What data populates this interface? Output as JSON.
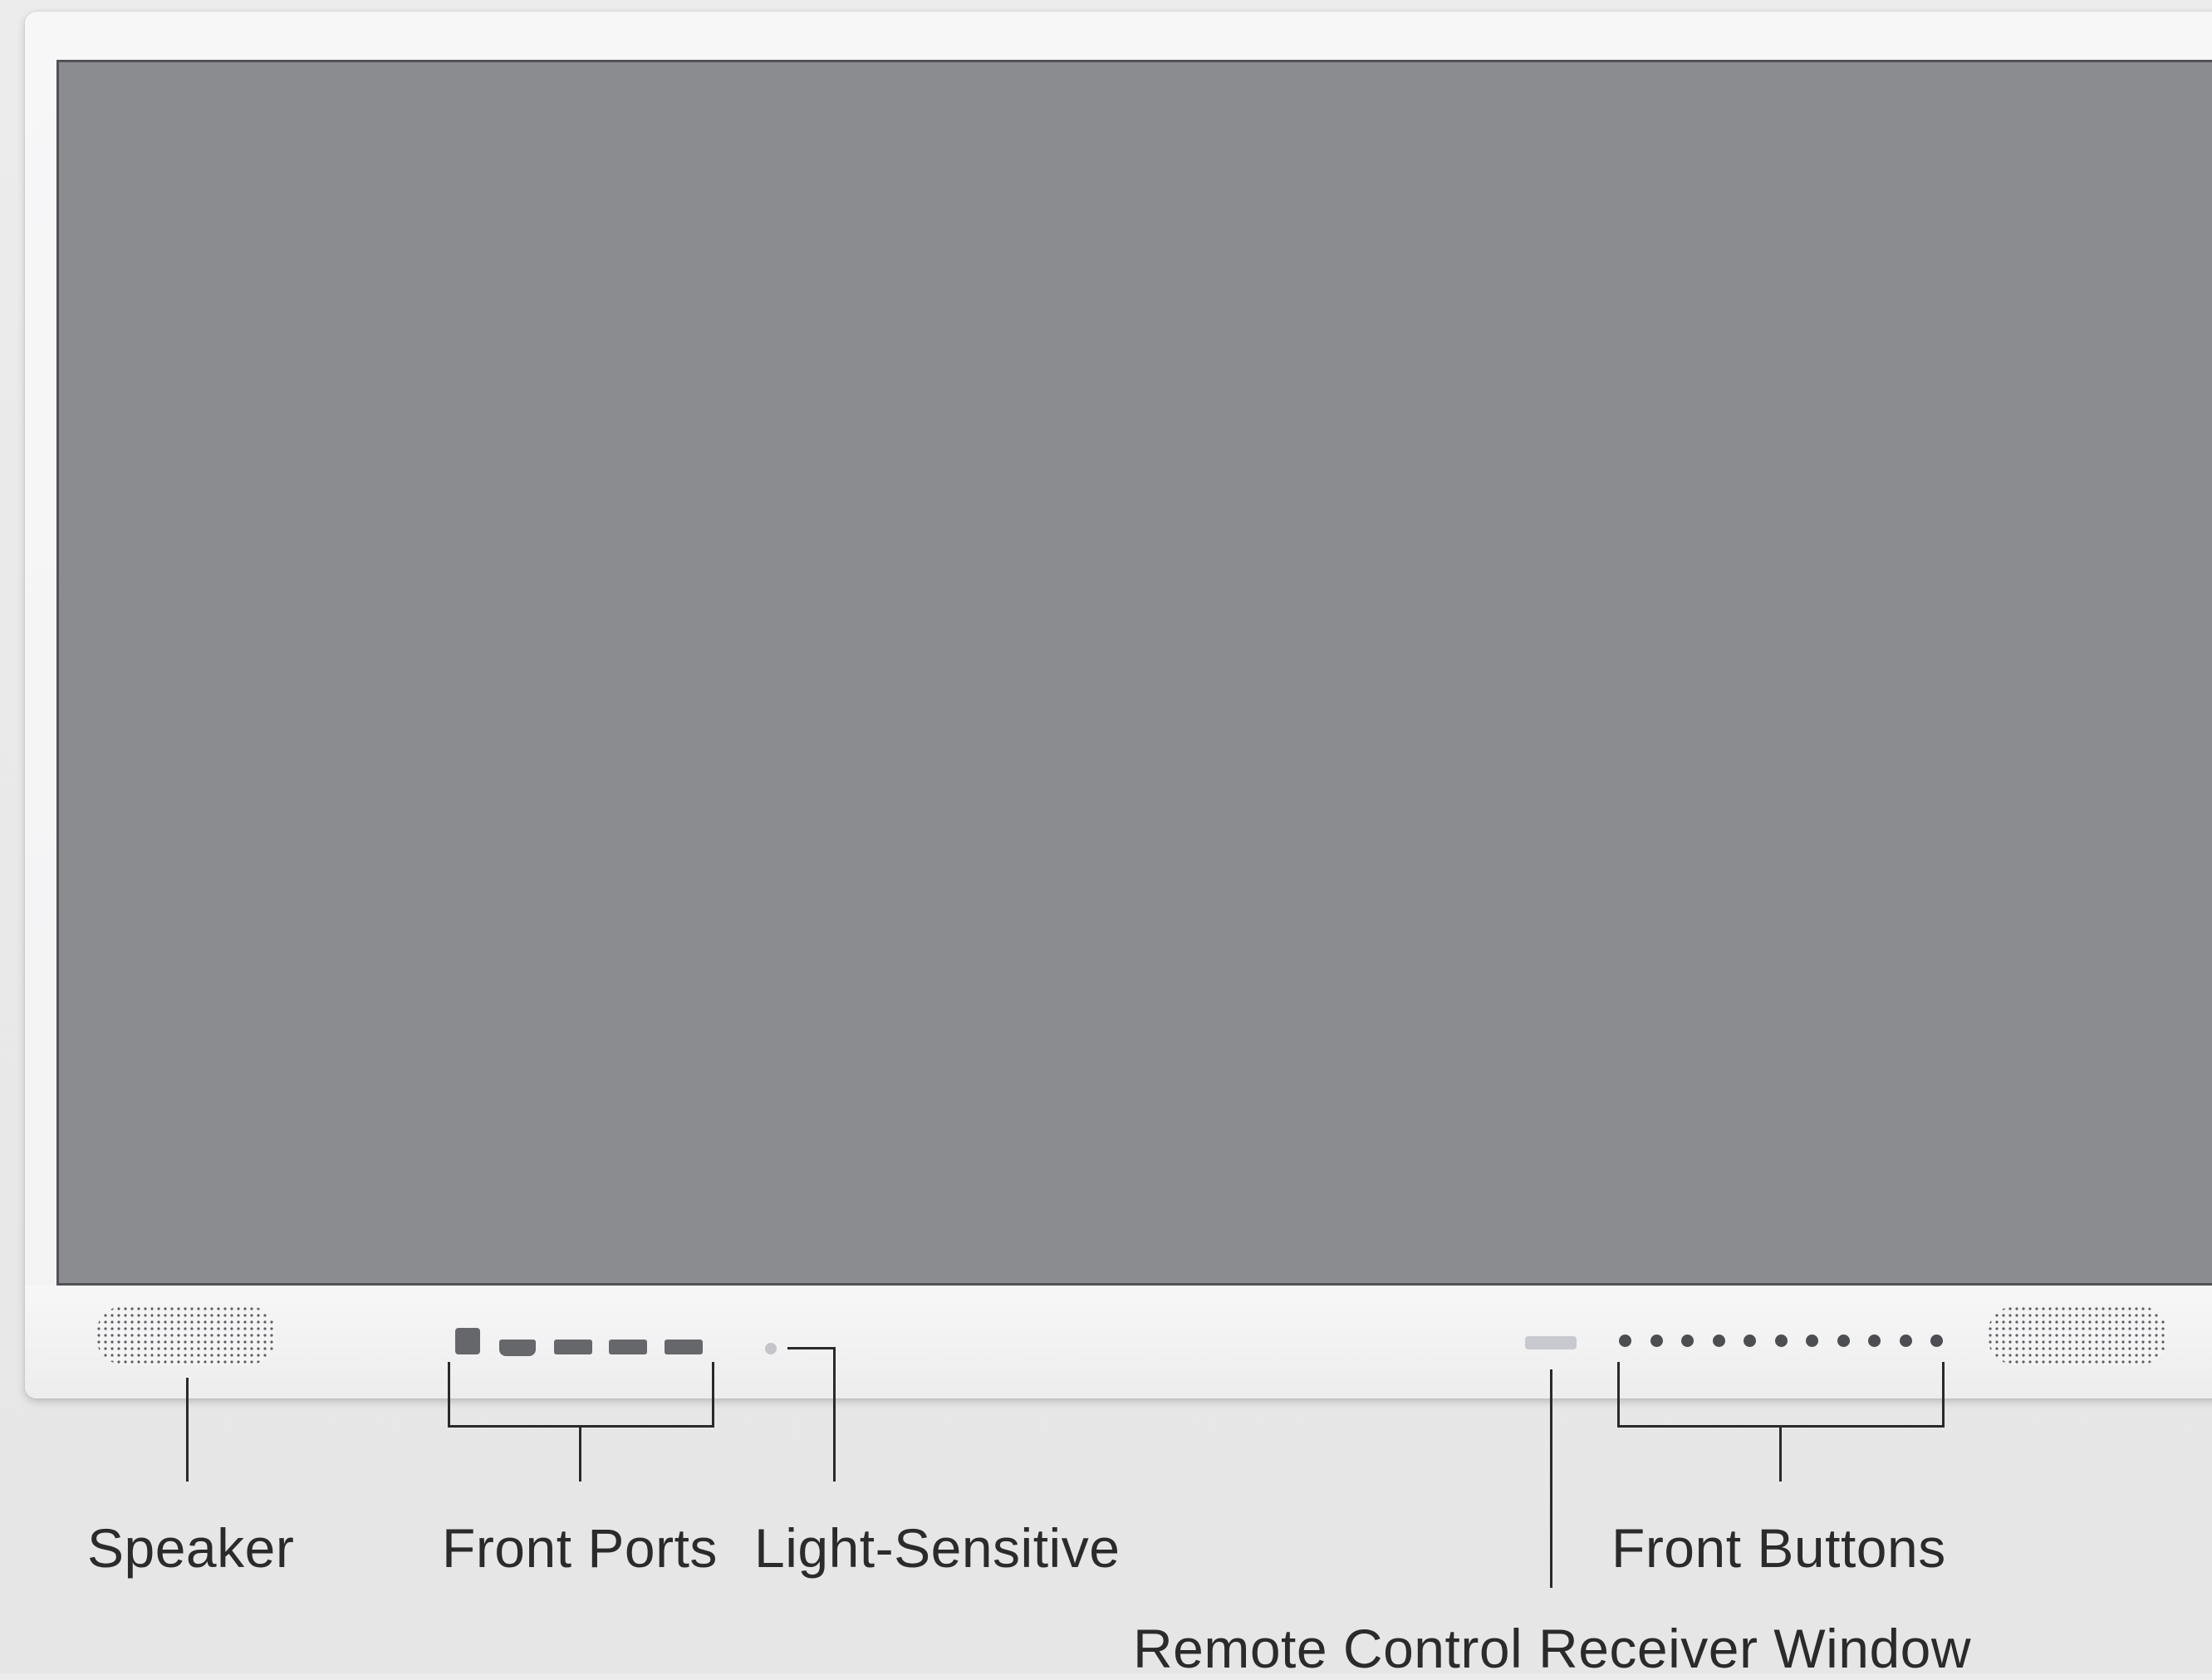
{
  "labels": {
    "speaker": "Speaker",
    "front_ports": "Front Ports",
    "light_sensitive": "Light-Sensitive",
    "front_buttons": "Front Buttons",
    "remote_window": "Remote Control Receiver Window"
  },
  "colors": {
    "screen": "#8b8c90",
    "bezel": "#f5f5f6",
    "background": "#e8e8e8",
    "leader_lines": "#2a2a2a"
  },
  "front_button_count": 11,
  "front_port_count": 5
}
